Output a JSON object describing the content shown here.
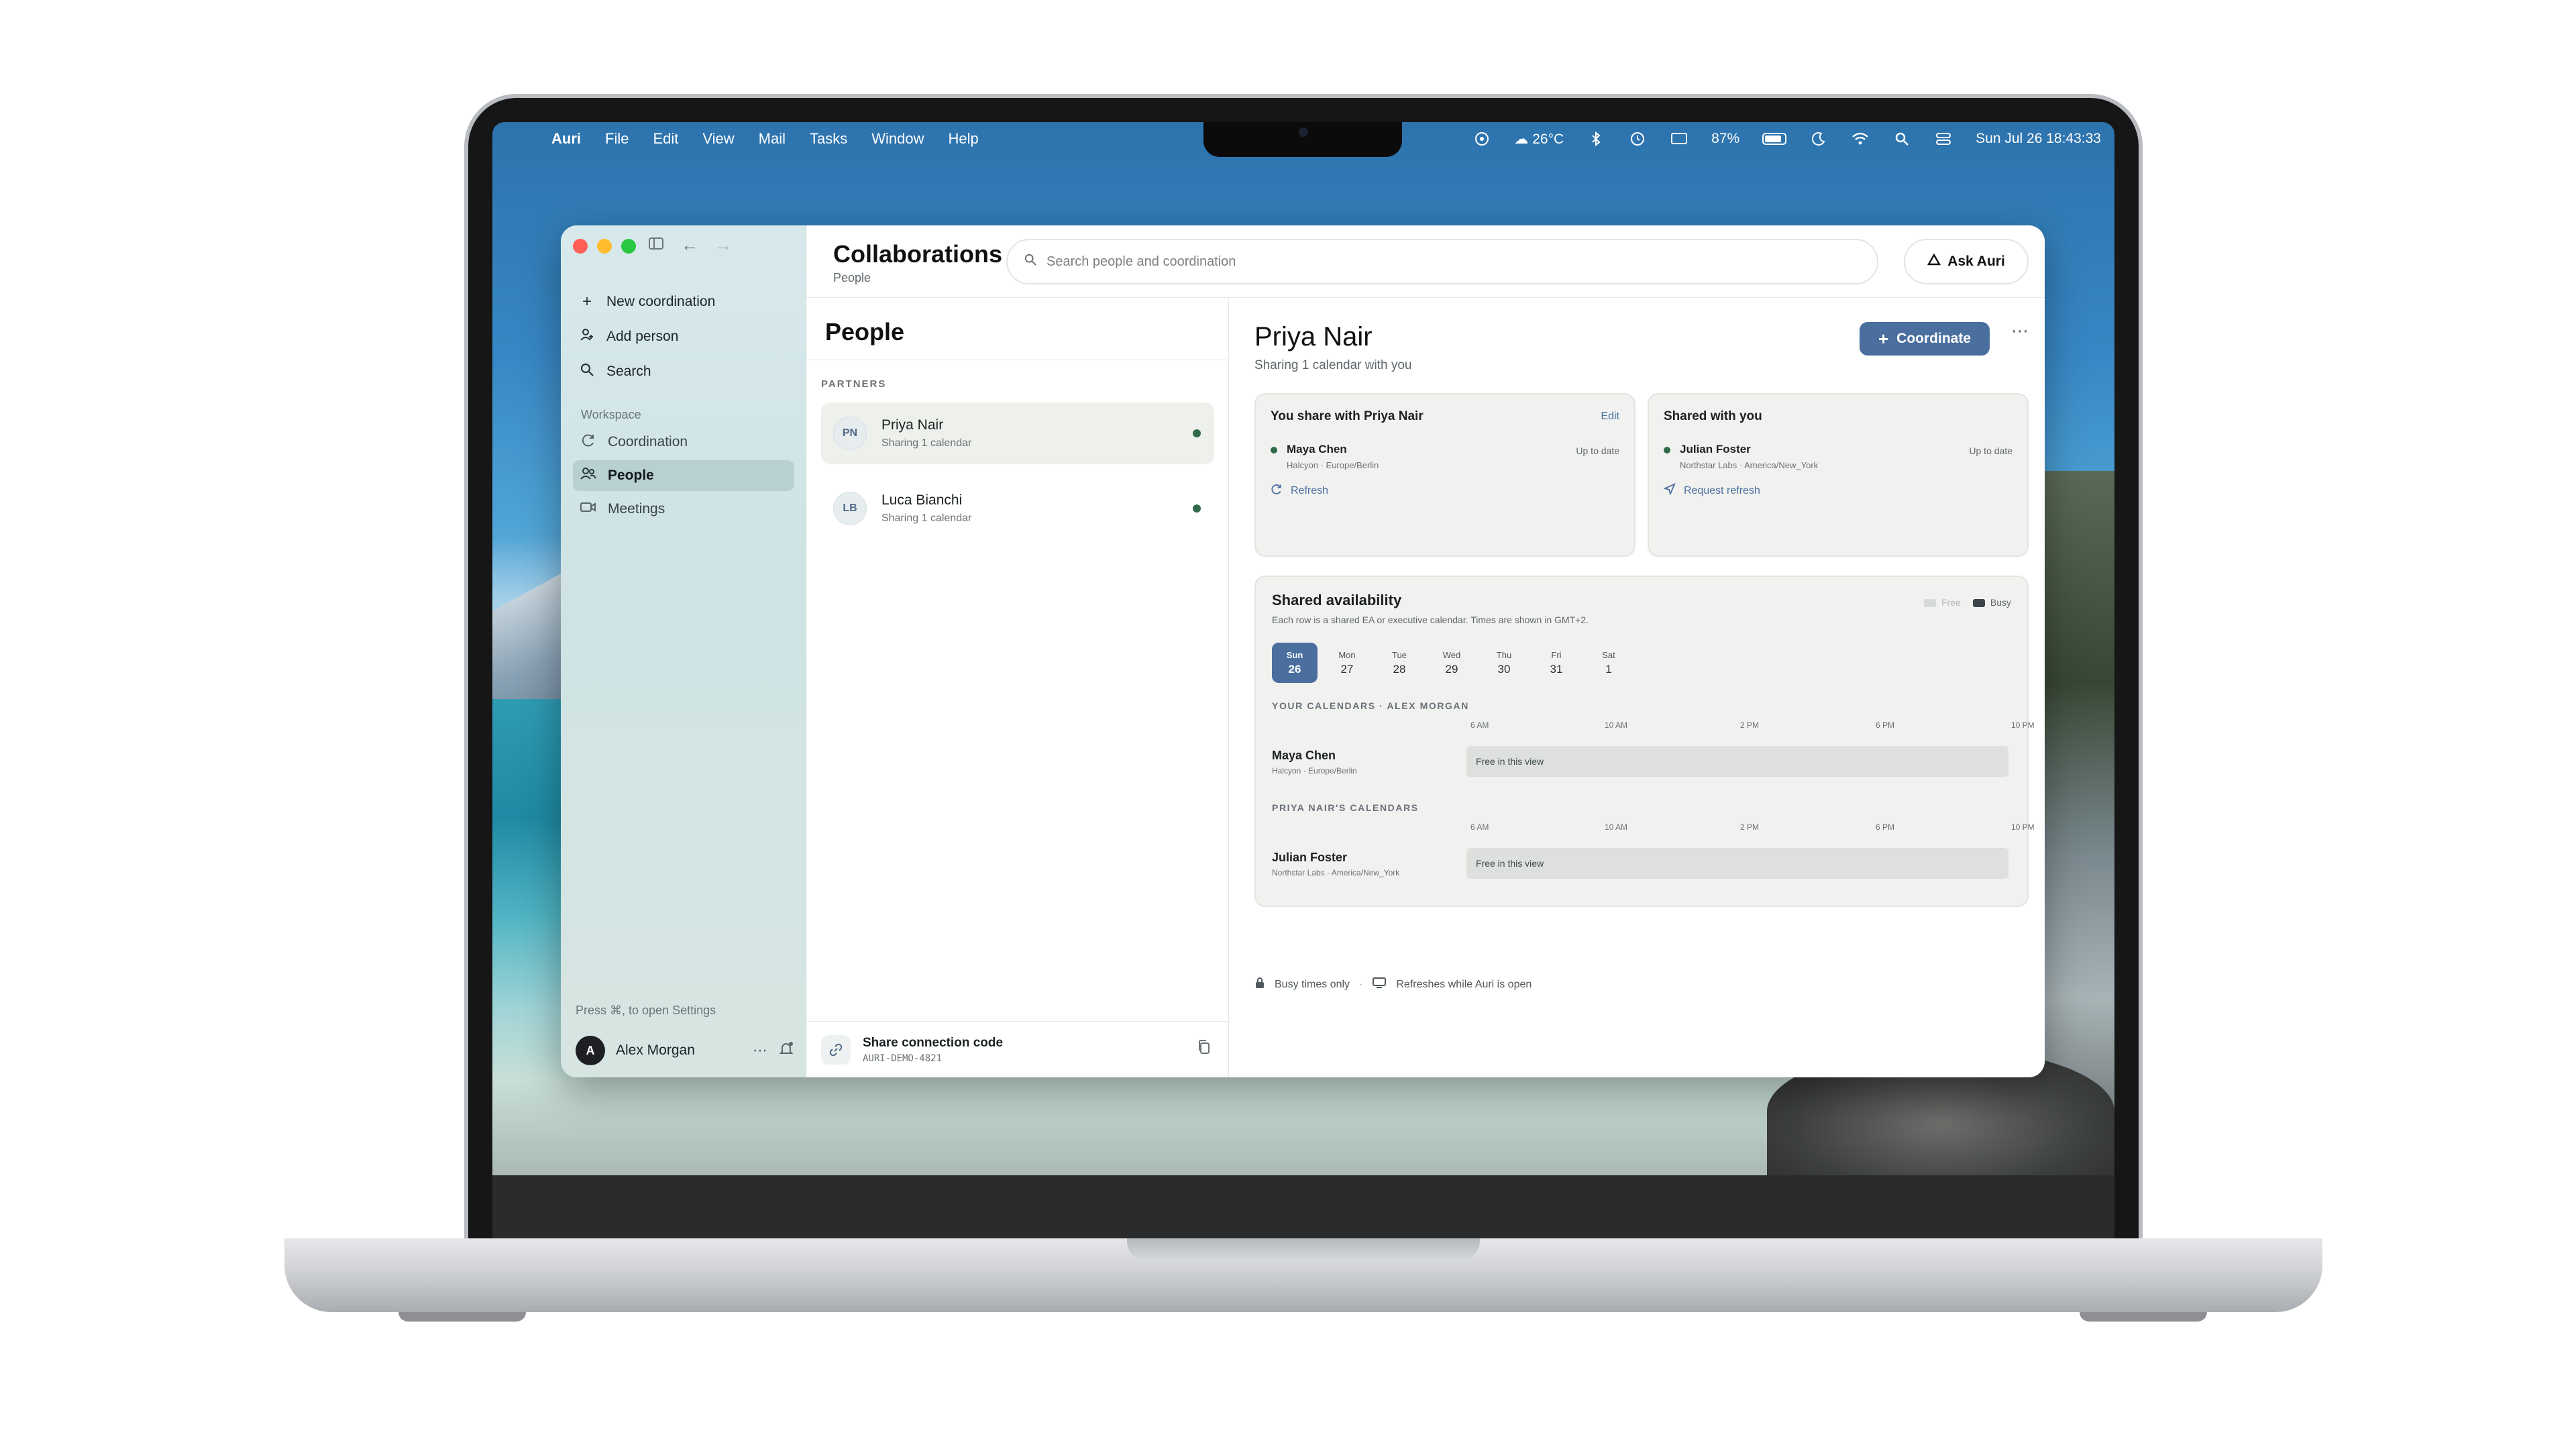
{
  "menubar": {
    "app_name": "Auri",
    "menus": [
      "File",
      "Edit",
      "View",
      "Mail",
      "Tasks",
      "Window",
      "Help"
    ],
    "weather": "26°C",
    "battery_percent": "87%",
    "battery_level": 0.87,
    "datetime": "Sun Jul 26  18:43:33"
  },
  "topbar": {
    "title": "Collaborations",
    "subtitle": "People",
    "search_placeholder": "Search people and coordination",
    "ask_label": "Ask Auri"
  },
  "sidebar": {
    "actions": [
      {
        "label": "New coordination",
        "icon": "plus-icon"
      },
      {
        "label": "Add person",
        "icon": "add-person-icon"
      },
      {
        "label": "Search",
        "icon": "search-icon"
      }
    ],
    "section_label": "Workspace",
    "nav": [
      {
        "label": "Coordination",
        "icon": "coordination-icon",
        "active": false
      },
      {
        "label": "People",
        "icon": "people-icon",
        "active": true
      },
      {
        "label": "Meetings",
        "icon": "video-icon",
        "active": false
      }
    ],
    "settings_hint": "Press ⌘, to open Settings",
    "user": {
      "initial": "A",
      "name": "Alex Morgan"
    }
  },
  "people": {
    "title": "People",
    "section_label": "PARTNERS",
    "items": [
      {
        "initials": "PN",
        "name": "Priya Nair",
        "sub": "Sharing 1 calendar",
        "active": true
      },
      {
        "initials": "LB",
        "name": "Luca Bianchi",
        "sub": "Sharing 1 calendar",
        "active": false
      }
    ],
    "share": {
      "title": "Share connection code",
      "code": "AURI-DEMO-4821"
    }
  },
  "detail": {
    "name": "Priya Nair",
    "sub": "Sharing 1 calendar with you",
    "coordinate_label": "Coordinate",
    "you_share": {
      "title": "You share with Priya Nair",
      "edit_label": "Edit",
      "calendar_name": "Maya Chen",
      "calendar_meta": "Halcyon · Europe/Berlin",
      "status": "Up to date",
      "link_label": "Refresh"
    },
    "shared_with_you": {
      "title": "Shared with you",
      "calendar_name": "Julian Foster",
      "calendar_meta": "Northstar Labs · America/New_York",
      "status": "Up to date",
      "link_label": "Request refresh"
    },
    "availability": {
      "title": "Shared availability",
      "subtitle": "Each row is a shared EA or executive calendar. Times are shown in GMT+2.",
      "legend_free": "Free",
      "legend_busy": "Busy",
      "days": [
        {
          "dow": "Sun",
          "num": "26",
          "active": true
        },
        {
          "dow": "Mon",
          "num": "27",
          "active": false
        },
        {
          "dow": "Tue",
          "num": "28",
          "active": false
        },
        {
          "dow": "Wed",
          "num": "29",
          "active": false
        },
        {
          "dow": "Thu",
          "num": "30",
          "active": false
        },
        {
          "dow": "Fri",
          "num": "31",
          "active": false
        },
        {
          "dow": "Sat",
          "num": "1",
          "active": false
        }
      ],
      "time_ticks": [
        "6 AM",
        "10 AM",
        "2 PM",
        "6 PM",
        "10 PM"
      ],
      "your_label": "YOUR CALENDARS · ALEX MORGAN",
      "your_row": {
        "name": "Maya Chen",
        "meta": "Halcyon · Europe/Berlin",
        "bar": "Free in this view"
      },
      "their_label": "PRIYA NAIR'S CALENDARS",
      "their_row": {
        "name": "Julian Foster",
        "meta": "Northstar Labs · America/New_York",
        "bar": "Free in this view"
      }
    },
    "footnote": {
      "busy_only": "Busy times only",
      "refresh": "Refreshes while Auri is open"
    }
  }
}
